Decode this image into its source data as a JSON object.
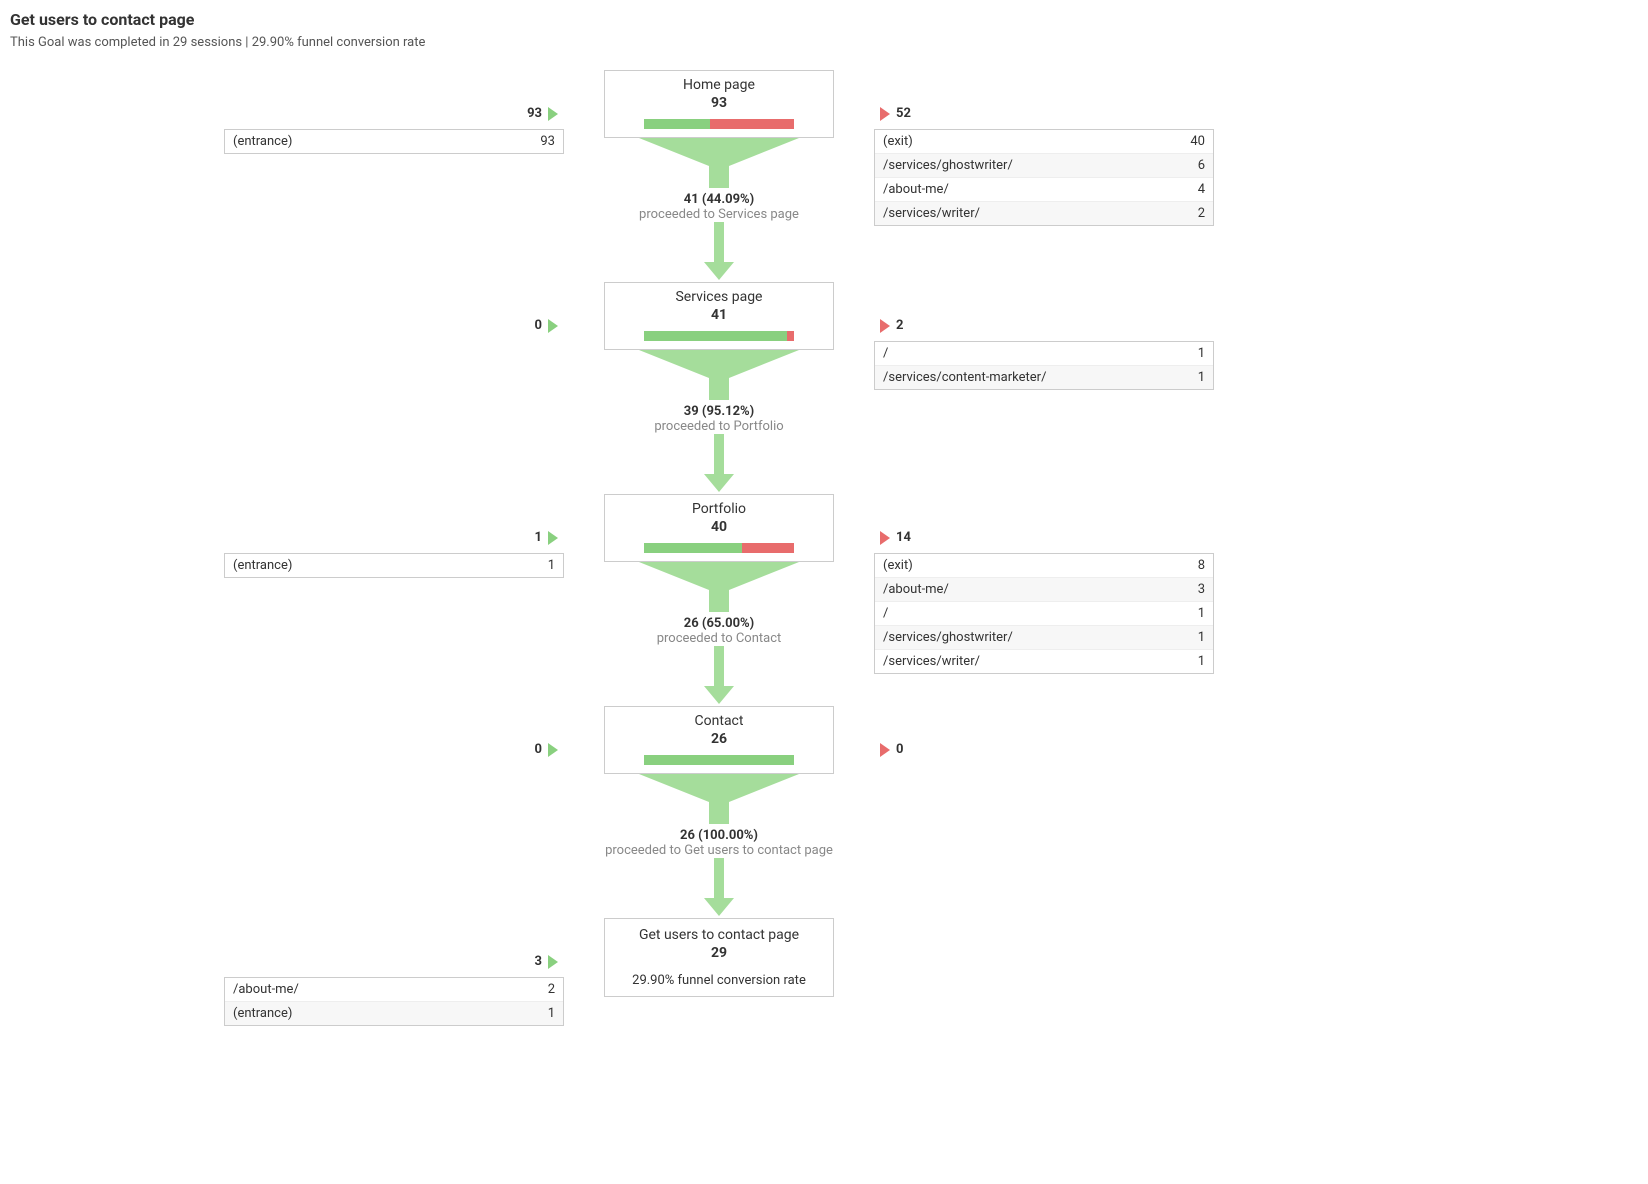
{
  "title": "Get users to contact page",
  "subtitle": "This Goal was completed in 29 sessions | 29.90% funnel conversion rate",
  "steps": [
    {
      "name": "Home page",
      "count": "93",
      "in_count": "93",
      "out_count": "52",
      "bar_green_pct": 44,
      "bar_red_pct": 56,
      "proceed_main": "41 (44.09%)",
      "proceed_sub": "proceeded to Services page",
      "in_rows": [
        {
          "label": "(entrance)",
          "value": "93"
        }
      ],
      "out_rows": [
        {
          "label": "(exit)",
          "value": "40"
        },
        {
          "label": "/services/ghostwriter/",
          "value": "6"
        },
        {
          "label": "/about-me/",
          "value": "4"
        },
        {
          "label": "/services/writer/",
          "value": "2"
        }
      ]
    },
    {
      "name": "Services page",
      "count": "41",
      "in_count": "0",
      "out_count": "2",
      "bar_green_pct": 95,
      "bar_red_pct": 5,
      "proceed_main": "39 (95.12%)",
      "proceed_sub": "proceeded to Portfolio",
      "in_rows": [],
      "out_rows": [
        {
          "label": "/",
          "value": "1"
        },
        {
          "label": "/services/content-marketer/",
          "value": "1"
        }
      ]
    },
    {
      "name": "Portfolio",
      "count": "40",
      "in_count": "1",
      "out_count": "14",
      "bar_green_pct": 65,
      "bar_red_pct": 35,
      "proceed_main": "26 (65.00%)",
      "proceed_sub": "proceeded to Contact",
      "in_rows": [
        {
          "label": "(entrance)",
          "value": "1"
        }
      ],
      "out_rows": [
        {
          "label": "(exit)",
          "value": "8"
        },
        {
          "label": "/about-me/",
          "value": "3"
        },
        {
          "label": "/",
          "value": "1"
        },
        {
          "label": "/services/ghostwriter/",
          "value": "1"
        },
        {
          "label": "/services/writer/",
          "value": "1"
        }
      ]
    },
    {
      "name": "Contact",
      "count": "26",
      "in_count": "0",
      "out_count": "0",
      "bar_green_pct": 100,
      "bar_red_pct": 0,
      "proceed_main": "26 (100.00%)",
      "proceed_sub": "proceeded to Get users to contact page",
      "in_rows": [],
      "out_rows": []
    }
  ],
  "final": {
    "name": "Get users to contact page",
    "count": "29",
    "in_count": "3",
    "rate": "29.90% funnel conversion rate",
    "in_rows": [
      {
        "label": "/about-me/",
        "value": "2"
      },
      {
        "label": "(entrance)",
        "value": "1"
      }
    ]
  },
  "chart_data": {
    "type": "funnel",
    "title": "Get users to contact page",
    "funnel_conversion_rate": 29.9,
    "completed_sessions": 29,
    "steps": [
      {
        "name": "Home page",
        "count": 93,
        "entered": 93,
        "exited": 52,
        "proceeded": 41,
        "proceed_pct": 44.09
      },
      {
        "name": "Services page",
        "count": 41,
        "entered": 0,
        "exited": 2,
        "proceeded": 39,
        "proceed_pct": 95.12
      },
      {
        "name": "Portfolio",
        "count": 40,
        "entered": 1,
        "exited": 14,
        "proceeded": 26,
        "proceed_pct": 65.0
      },
      {
        "name": "Contact",
        "count": 26,
        "entered": 0,
        "exited": 0,
        "proceeded": 26,
        "proceed_pct": 100.0
      },
      {
        "name": "Get users to contact page",
        "count": 29,
        "entered": 3
      }
    ]
  }
}
